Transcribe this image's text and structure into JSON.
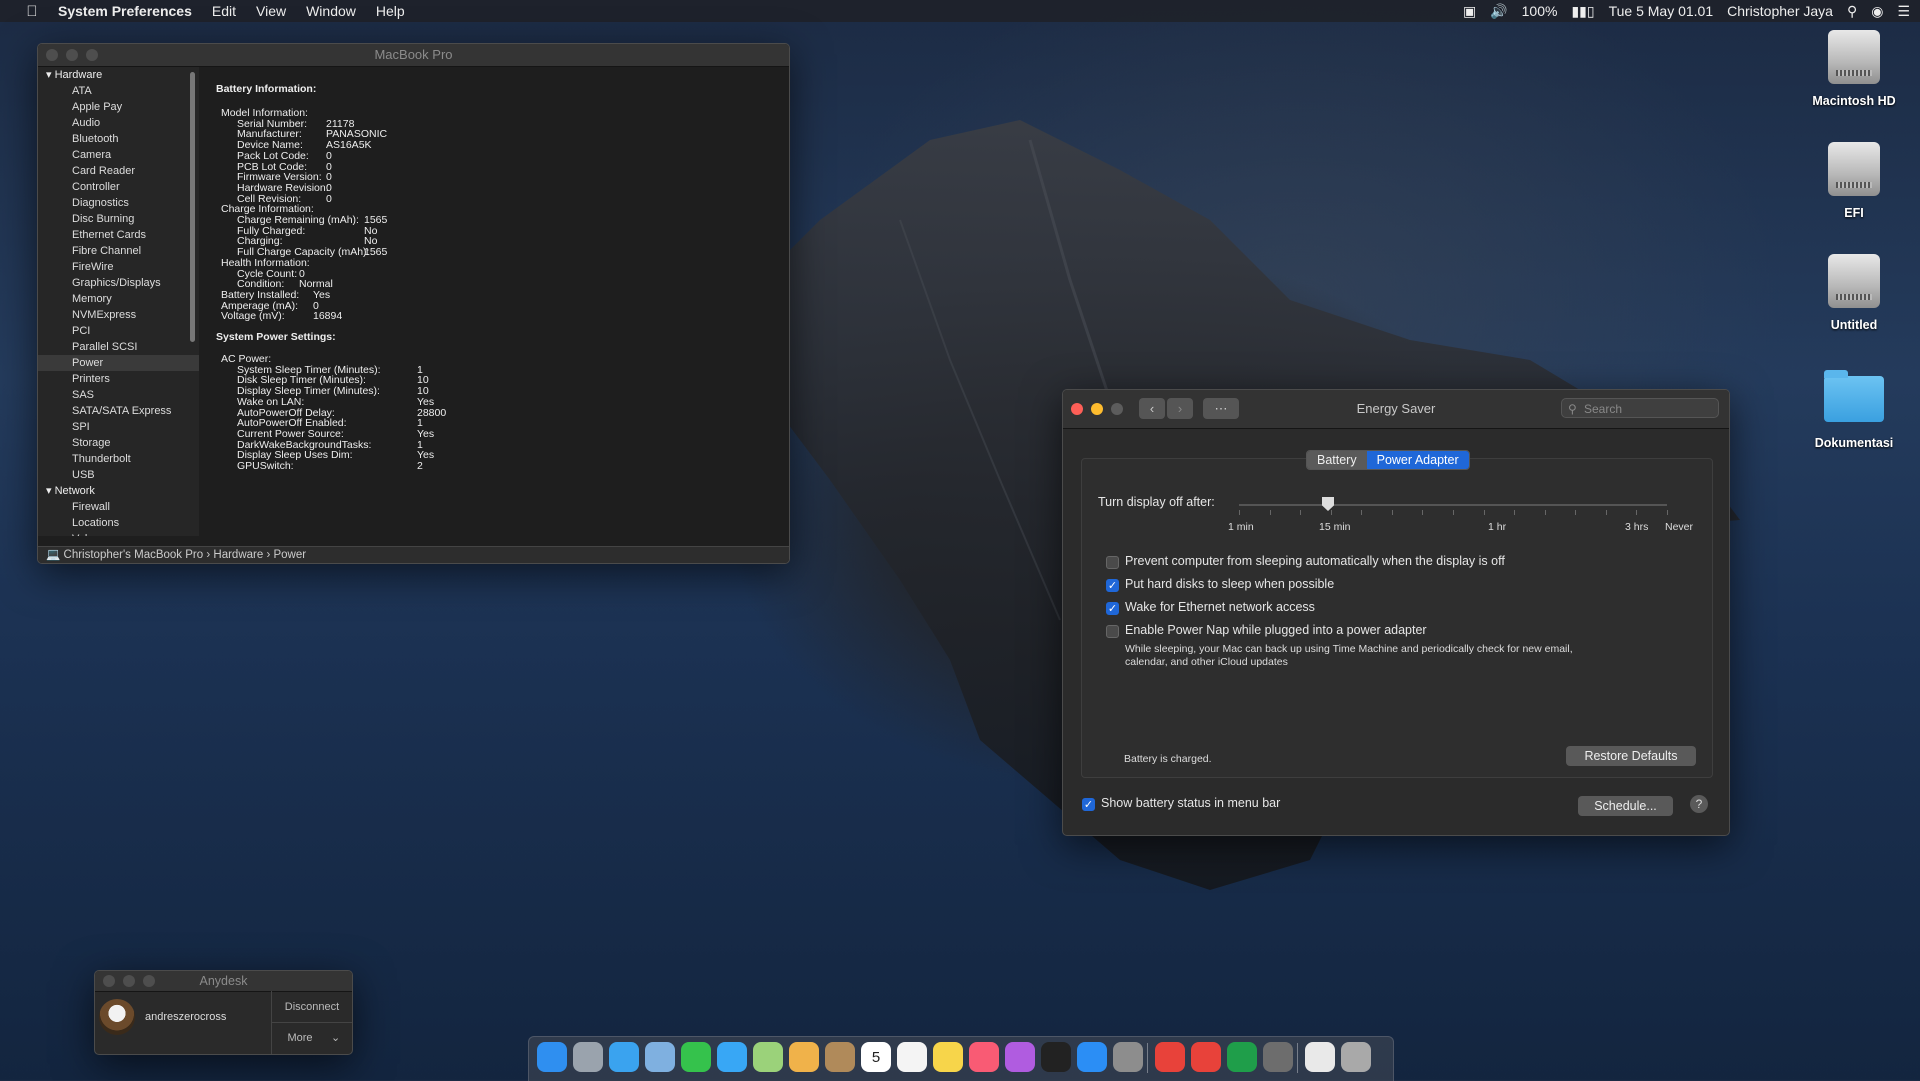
{
  "menubar": {
    "apple": "",
    "app": "System Preferences",
    "items": [
      "Edit",
      "View",
      "Window",
      "Help"
    ],
    "battery_pct": "100%",
    "datetime": "Tue 5 May 01.01",
    "user": "Christopher Jaya"
  },
  "sysinfo": {
    "title": "MacBook Pro",
    "sidebar": {
      "hardware": "Hardware",
      "items": [
        "ATA",
        "Apple Pay",
        "Audio",
        "Bluetooth",
        "Camera",
        "Card Reader",
        "Controller",
        "Diagnostics",
        "Disc Burning",
        "Ethernet Cards",
        "Fibre Channel",
        "FireWire",
        "Graphics/Displays",
        "Memory",
        "NVMExpress",
        "PCI",
        "Parallel SCSI",
        "Power",
        "Printers",
        "SAS",
        "SATA/SATA Express",
        "SPI",
        "Storage",
        "Thunderbolt",
        "USB"
      ],
      "selected": "Power",
      "network": "Network",
      "network_items": [
        "Firewall",
        "Locations",
        "Volumes"
      ]
    },
    "battery_heading": "Battery Information:",
    "model_info": "Model Information:",
    "model_rows": [
      [
        "Serial Number:",
        "21178"
      ],
      [
        "Manufacturer:",
        "PANASONIC"
      ],
      [
        "Device Name:",
        "AS16A5K"
      ],
      [
        "Pack Lot Code:",
        "0"
      ],
      [
        "PCB Lot Code:",
        "0"
      ],
      [
        "Firmware Version:",
        "0"
      ],
      [
        "Hardware Revision:",
        "0"
      ],
      [
        "Cell Revision:",
        "0"
      ]
    ],
    "charge_info": "Charge Information:",
    "charge_rows": [
      [
        "Charge Remaining (mAh):",
        "1565"
      ],
      [
        "Fully Charged:",
        "No"
      ],
      [
        "Charging:",
        "No"
      ],
      [
        "Full Charge Capacity (mAh):",
        "1565"
      ]
    ],
    "health_info": "Health Information:",
    "health_rows": [
      [
        "Cycle Count:",
        "0"
      ],
      [
        "Condition:",
        "Normal"
      ]
    ],
    "top_rows": [
      [
        "Battery Installed:",
        "Yes"
      ],
      [
        "Amperage (mA):",
        "0"
      ],
      [
        "Voltage (mV):",
        "16894"
      ]
    ],
    "power_heading": "System Power Settings:",
    "ac_power": "AC Power:",
    "ac_rows": [
      [
        "System Sleep Timer (Minutes):",
        "1"
      ],
      [
        "Disk Sleep Timer (Minutes):",
        "10"
      ],
      [
        "Display Sleep Timer (Minutes):",
        "10"
      ],
      [
        "Wake on LAN:",
        "Yes"
      ],
      [
        "AutoPowerOff Delay:",
        "28800"
      ],
      [
        "AutoPowerOff Enabled:",
        "1"
      ],
      [
        "Current Power Source:",
        "Yes"
      ],
      [
        "DarkWakeBackgroundTasks:",
        "1"
      ],
      [
        "Display Sleep Uses Dim:",
        "Yes"
      ],
      [
        "GPUSwitch:",
        "2"
      ]
    ],
    "path": [
      "Christopher's MacBook Pro",
      "Hardware",
      "Power"
    ]
  },
  "energy": {
    "title": "Energy Saver",
    "search_placeholder": "Search",
    "tabs": [
      "Battery",
      "Power Adapter"
    ],
    "active_tab": "Power Adapter",
    "slider_label": "Turn display off after:",
    "slider_ticks": [
      "1 min",
      "15 min",
      "1 hr",
      "3 hrs",
      "Never"
    ],
    "slider_value": "10 min",
    "options": [
      {
        "label": "Prevent computer from sleeping automatically when the display is off",
        "checked": false
      },
      {
        "label": "Put hard disks to sleep when possible",
        "checked": true
      },
      {
        "label": "Wake for Ethernet network access",
        "checked": true
      },
      {
        "label": "Enable Power Nap while plugged into a power adapter",
        "checked": false
      }
    ],
    "powernap_note_1": "While sleeping, your Mac can back up using Time Machine and periodically check for new email,",
    "powernap_note_2": "calendar, and other iCloud updates",
    "status": "Battery is charged.",
    "restore_defaults": "Restore Defaults",
    "show_battery": "Show battery status in menu bar",
    "schedule": "Schedule...",
    "help": "?"
  },
  "anydesk": {
    "title": "Anydesk",
    "user": "andreszerocross",
    "disconnect": "Disconnect",
    "more": "More"
  },
  "desktop": {
    "icons": [
      "Macintosh HD",
      "EFI",
      "Untitled",
      "Dokumentasi"
    ]
  },
  "dock": {
    "calendar_day": "5"
  },
  "colors": {
    "accent": "#1f67d8",
    "close": "#fe5f57",
    "minimize": "#febc2e"
  }
}
